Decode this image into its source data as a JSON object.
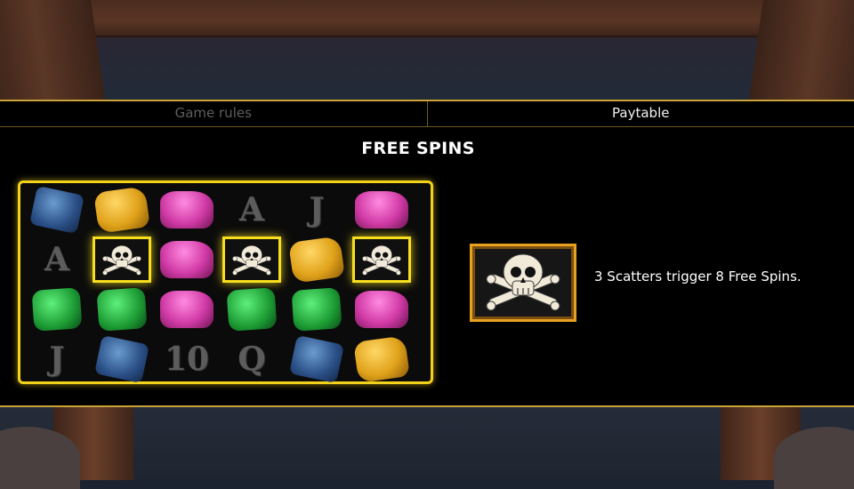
{
  "tabs": [
    {
      "label": "Game rules",
      "active": false
    },
    {
      "label": "Paytable",
      "active": true
    }
  ],
  "section_title": "FREE SPINS",
  "reel_grid": {
    "rows": [
      [
        "blue-gem",
        "yellow-gem",
        "pink-gem",
        "A",
        "J",
        "pink-gem"
      ],
      [
        "A",
        "scatter",
        "pink-gem",
        "scatter",
        "yellow-gem",
        "scatter"
      ],
      [
        "green-gem",
        "green-gem",
        "pink-gem",
        "green-gem",
        "green-gem",
        "pink-gem"
      ],
      [
        "J",
        "blue-gem",
        "10",
        "Q",
        "blue-gem",
        "yellow-gem"
      ]
    ],
    "highlight_color": "#f2d21b"
  },
  "scatter_info": {
    "icon": "skull-crossbones-icon",
    "description": "3 Scatters trigger 8 Free Spins."
  },
  "colors": {
    "accent_gold": "#c9a23a",
    "scatter_frame": "#e8a11e"
  }
}
